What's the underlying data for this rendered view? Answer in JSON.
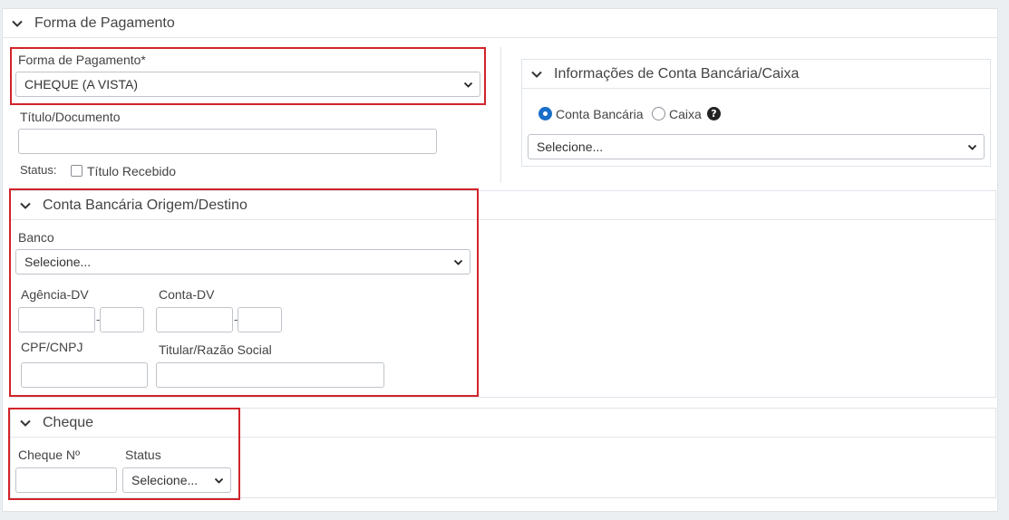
{
  "forma_pagamento_panel": {
    "title": "Forma de Pagamento",
    "forma_label": "Forma de Pagamento*",
    "forma_value": "CHEQUE (A VISTA)",
    "titulo_label": "Título/Documento",
    "titulo_value": "",
    "status_label": "Status:",
    "titulo_recebido_label": "Título Recebido",
    "titulo_recebido_checked": false
  },
  "conta_info_panel": {
    "title": "Informações de Conta Bancária/Caixa",
    "radio_conta_label": "Conta Bancária",
    "radio_caixa_label": "Caixa",
    "selected": "Conta Bancária",
    "help_glyph": "?",
    "select_value": "Selecione..."
  },
  "conta_origem_panel": {
    "title": "Conta Bancária Origem/Destino",
    "banco_label": "Banco",
    "banco_value": "Selecione...",
    "agencia_label": "Agência-DV",
    "conta_label": "Conta-DV",
    "separator": "-",
    "cpf_label": "CPF/CNPJ",
    "titular_label": "Titular/Razão Social"
  },
  "cheque_panel": {
    "title": "Cheque",
    "cheque_numero_label": "Cheque Nº",
    "status_label": "Status",
    "status_value": "Selecione..."
  },
  "colors": {
    "accent": "#1a6fc9",
    "highlight": "#d2232a",
    "border": "#bfc4ca"
  }
}
